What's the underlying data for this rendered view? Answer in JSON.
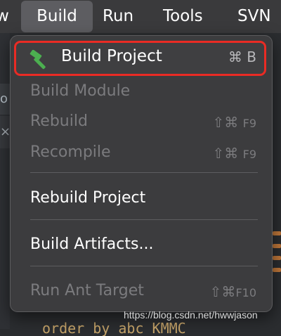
{
  "menubar": {
    "view_edge": "w",
    "build": "Build",
    "run": "Run",
    "tools": "Tools",
    "svn": "SVN"
  },
  "background": {
    "left_tab_1": "o",
    "left_tab_2": "×",
    "code_snippet": "order by abc KMMC"
  },
  "menu": {
    "items": [
      {
        "label": "Build Project",
        "shortcut": "⌘ B",
        "enabled": true,
        "icon": "hammer-icon"
      },
      {
        "label": "Build Module",
        "shortcut": "",
        "enabled": false
      },
      {
        "label": "Rebuild",
        "shortcut": "⇧⌘",
        "shortcut_key": "F9",
        "enabled": false
      },
      {
        "label": "Recompile",
        "shortcut": "⇧⌘",
        "shortcut_key": "F9",
        "enabled": false
      },
      {
        "label": "Rebuild Project",
        "shortcut": "",
        "enabled": true
      },
      {
        "label": "Build Artifacts...",
        "shortcut": "",
        "enabled": true
      },
      {
        "label": "Run Ant Target",
        "shortcut": "⇧⌘",
        "shortcut_key": "F10",
        "enabled": false
      }
    ]
  },
  "colors": {
    "highlight_border": "#ea2b24",
    "hammer": "#4caf50",
    "menu_bg": "#3c3c3e"
  },
  "watermark": "https://blog.csdn.net/hwwjason"
}
